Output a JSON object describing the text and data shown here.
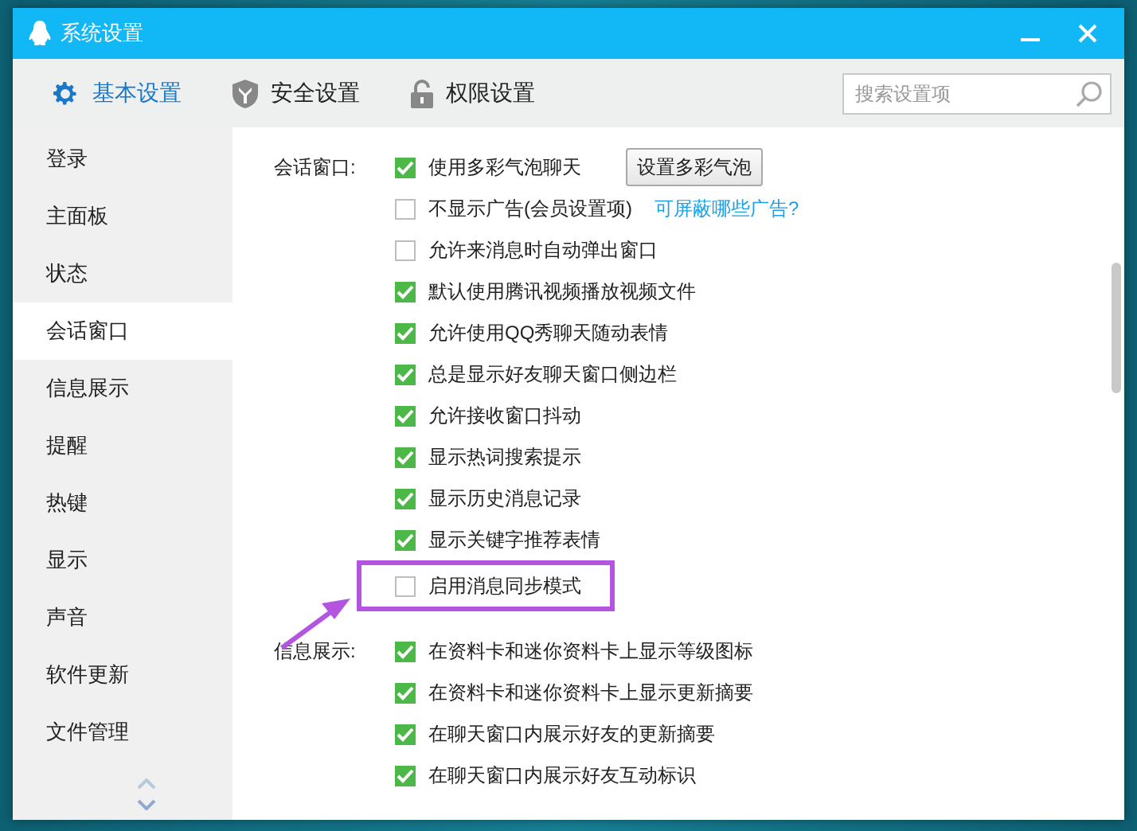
{
  "window": {
    "title": "系统设置"
  },
  "tabs": [
    {
      "label": "基本设置",
      "selected": true,
      "kind": "gear"
    },
    {
      "label": "安全设置",
      "selected": false,
      "kind": "shield"
    },
    {
      "label": "权限设置",
      "selected": false,
      "kind": "lock"
    }
  ],
  "search": {
    "placeholder": "搜索设置项"
  },
  "sidebar": {
    "items": [
      {
        "label": "登录",
        "selected": false
      },
      {
        "label": "主面板",
        "selected": false
      },
      {
        "label": "状态",
        "selected": false
      },
      {
        "label": "会话窗口",
        "selected": true
      },
      {
        "label": "信息展示",
        "selected": false
      },
      {
        "label": "提醒",
        "selected": false
      },
      {
        "label": "热键",
        "selected": false
      },
      {
        "label": "显示",
        "selected": false
      },
      {
        "label": "声音",
        "selected": false
      },
      {
        "label": "软件更新",
        "selected": false
      },
      {
        "label": "文件管理",
        "selected": false
      }
    ]
  },
  "sections": [
    {
      "label": "会话窗口:",
      "items": [
        {
          "label": "使用多彩气泡聊天",
          "checked": true,
          "highlighted": false,
          "button": "设置多彩气泡"
        },
        {
          "label": "不显示广告(会员设置项)",
          "checked": false,
          "highlighted": false,
          "link": "可屏蔽哪些广告?"
        },
        {
          "label": "允许来消息时自动弹出窗口",
          "checked": false,
          "highlighted": false
        },
        {
          "label": "默认使用腾讯视频播放视频文件",
          "checked": true,
          "highlighted": false
        },
        {
          "label": "允许使用QQ秀聊天随动表情",
          "checked": true,
          "highlighted": false
        },
        {
          "label": "总是显示好友聊天窗口侧边栏",
          "checked": true,
          "highlighted": false
        },
        {
          "label": "允许接收窗口抖动",
          "checked": true,
          "highlighted": false
        },
        {
          "label": "显示热词搜索提示",
          "checked": true,
          "highlighted": false
        },
        {
          "label": "显示历史消息记录",
          "checked": true,
          "highlighted": false
        },
        {
          "label": "显示关键字推荐表情",
          "checked": true,
          "highlighted": false
        },
        {
          "label": "启用消息同步模式",
          "checked": false,
          "highlighted": true
        }
      ]
    },
    {
      "label": "信息展示:",
      "items": [
        {
          "label": "在资料卡和迷你资料卡上显示等级图标",
          "checked": true,
          "highlighted": false
        },
        {
          "label": "在资料卡和迷你资料卡上显示更新摘要",
          "checked": true,
          "highlighted": false
        },
        {
          "label": "在聊天窗口内展示好友的更新摘要",
          "checked": true,
          "highlighted": false
        },
        {
          "label": "在聊天窗口内展示好友互动标识",
          "checked": true,
          "highlighted": false
        }
      ]
    }
  ]
}
